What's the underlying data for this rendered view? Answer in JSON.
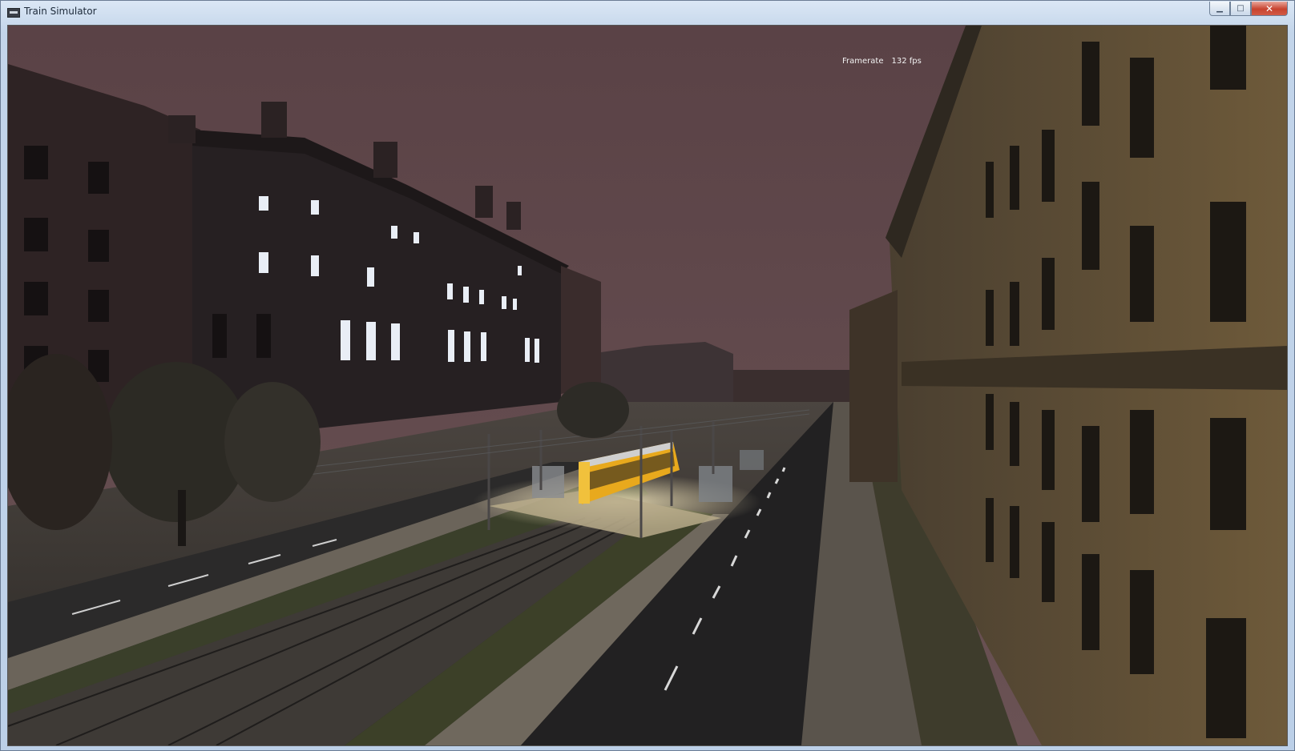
{
  "window": {
    "title": "Train Simulator",
    "icon": "train-app-icon",
    "controls": {
      "minimize": "minimize-icon",
      "maximize": "maximize-icon",
      "close": "close-icon"
    }
  },
  "hud": {
    "framerate_label": "Framerate",
    "framerate_value": "132 fps"
  },
  "scene": {
    "sky_color": "#5c4549",
    "tram_color": "#e8a91d",
    "building_right_color": "#5a4a30",
    "building_left_color": "#2b2224"
  }
}
